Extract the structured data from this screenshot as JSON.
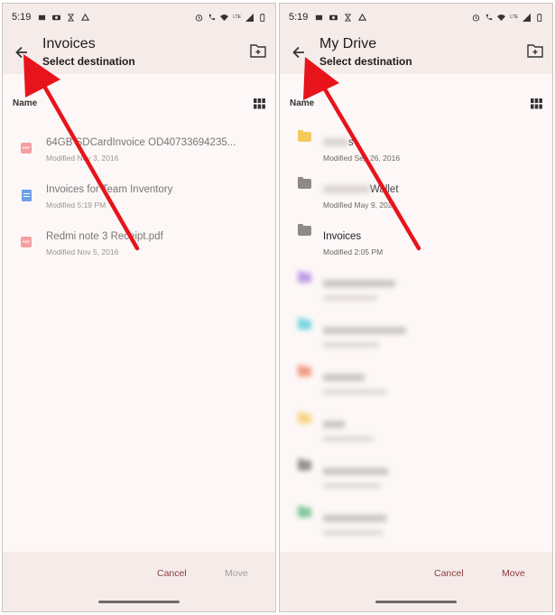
{
  "status_bar": {
    "time": "5:19",
    "network": "LTE"
  },
  "left_panel": {
    "title": "Invoices",
    "subtitle": "Select destination",
    "sort_label": "Name",
    "items": [
      {
        "name": "64GB SDCardInvoice OD40733694235...",
        "meta": "Modified Nov 3, 2016",
        "icon": "pdf-icon",
        "badge": "PDF"
      },
      {
        "name": "Invoices for Team Inventory",
        "meta": "Modified 5:19 PM",
        "icon": "document-icon"
      },
      {
        "name": "Redmi note 3 Receipt.pdf",
        "meta": "Modified Nov 5, 2016",
        "icon": "pdf-icon",
        "badge": "PDF"
      }
    ],
    "cancel_label": "Cancel",
    "move_label": "Move"
  },
  "right_panel": {
    "title": "My Drive",
    "subtitle": "Select destination",
    "sort_label": "Name",
    "items": [
      {
        "name": "s",
        "meta": "Modified Sep 26, 2016",
        "icon": "folder-icon",
        "color": "#f6c95c"
      },
      {
        "name": "Wallet",
        "meta": "Modified May 9, 2021",
        "icon": "folder-icon",
        "color": "#8f8a89"
      },
      {
        "name": "Invoices",
        "meta": "Modified 2:05 PM",
        "icon": "folder-icon",
        "color": "#8f8a89"
      },
      {
        "name": "",
        "meta": "",
        "icon": "folder-icon",
        "color": "#a97be0"
      },
      {
        "name": "",
        "meta": "",
        "icon": "folder-icon",
        "color": "#4dc9d8"
      },
      {
        "name": "",
        "meta": "",
        "icon": "folder-icon",
        "color": "#f07a5e"
      },
      {
        "name": "",
        "meta": "",
        "icon": "folder-icon",
        "color": "#f6c95c"
      },
      {
        "name": "",
        "meta": "",
        "icon": "folder-icon",
        "color": "#6f6a69"
      },
      {
        "name": "",
        "meta": "",
        "icon": "folder-icon",
        "color": "#56b87a"
      }
    ],
    "cancel_label": "Cancel",
    "move_label": "Move"
  },
  "colors": {
    "accent": "#8a3a3a",
    "annotation_arrow": "#e8141b",
    "bar_background": "#f5ecea"
  }
}
